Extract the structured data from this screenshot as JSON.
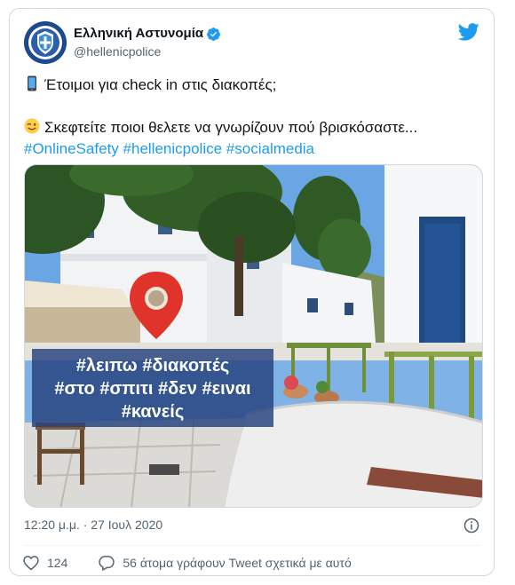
{
  "tweet": {
    "author": {
      "display_name": "Ελληνική Αστυνομία",
      "handle": "@hellenicpolice",
      "avatar_icon": "police-badge-icon",
      "verified": true
    },
    "text_line1": "Έτοιμοι για check in στις διακοπές;",
    "text_line2": "Σκεφτείτε ποιοι θελετε να γνωρίζουν πού βρισκόσαστε...",
    "hashtags": [
      "#OnlineSafety",
      "#hellenicpolice",
      "#socialmedia"
    ],
    "image_overlay": {
      "line1": "#λειπω #διακοπές",
      "line2": "#στο #σπιτι #δεν #ειναι",
      "line3": "#κανείς"
    },
    "timestamp": "12:20 μ.μ. · 27 Ιουλ 2020",
    "like_count": "124",
    "conversation_text": "56 άτομα γράφουν Tweet σχετικά με αυτό"
  },
  "colors": {
    "accent": "#1d9bf0",
    "overlay": "#23417d",
    "pin": "#e0332a"
  }
}
